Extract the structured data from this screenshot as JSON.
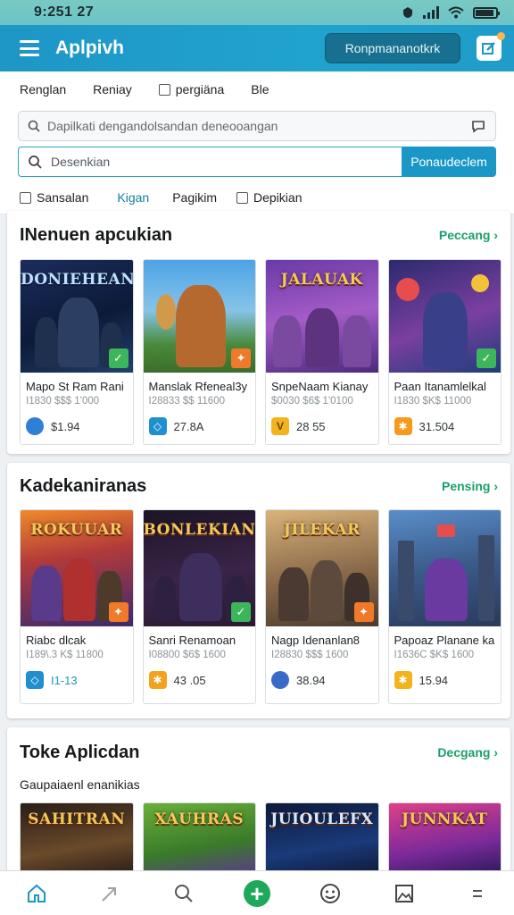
{
  "status_bar": {
    "time": "9:251  27"
  },
  "header": {
    "title": "Aplpivh",
    "action_label": "Ronpmananotkrk",
    "icon": "edit-icon"
  },
  "filters": {
    "item1": "Renglan",
    "item2": "Reniay",
    "item3": "pergiäna",
    "item4": "Ble"
  },
  "search": {
    "top_placeholder": "Dapilkati dengandolsandan  deneooangan",
    "main_placeholder": "Desenkian",
    "button_label": "Ponaudeclem"
  },
  "tabs": {
    "tab1": "Sansalan",
    "tab2": "Kigan",
    "tab3": "Pagikim",
    "tab4": "Depikian"
  },
  "sections": [
    {
      "title": "INenuen apcukian",
      "see_all": "Peccang ›",
      "cards": [
        {
          "art": "DONIEHEAN",
          "name": "Mapo St Ram Rani",
          "sub": "I1830 $$$ 1'000",
          "price": "$1.94"
        },
        {
          "art": "",
          "name": "Manslak Rfeneal3y",
          "sub": "I28833 $$ 11600",
          "price": "27.8A"
        },
        {
          "art": "JALAUAK",
          "name": "SnpeNaam Kianay",
          "sub": "$0030 $6$ 1'0100",
          "price": "28 55"
        },
        {
          "art": "",
          "name": "Paan Itanamlelkal",
          "sub": "I1830 $K$ 11000",
          "price": "31.504"
        }
      ]
    },
    {
      "title": "Kadekaniranas",
      "see_all": "Pensing ›",
      "cards": [
        {
          "art": "ROKUUAR",
          "name": "Riabc dlcak",
          "sub": "I189\\.3 K$ 11800",
          "price": "I1-13"
        },
        {
          "art": "BONLEKIAN",
          "name": "Sanri Renamoan",
          "sub": "I08800 $6$ 1600",
          "price": "43 .05"
        },
        {
          "art": "JILEKAR",
          "name": "Nagp Idenanlan8",
          "sub": "I28830 $$$ 1600",
          "price": "38.94"
        },
        {
          "art": "",
          "name": "Papoaz Planane ka",
          "sub": "I1636C $K$ 1600",
          "price": "15.94"
        }
      ]
    },
    {
      "title": "Toke Aplicdan",
      "see_all": "Decgang ›",
      "subheading": "Gaupaiaenl enanikias",
      "cards": [
        {
          "art": "SAHITRAN",
          "name": "",
          "sub": "",
          "price": ""
        },
        {
          "art": "XAUHRAS",
          "name": "",
          "sub": "",
          "price": ""
        },
        {
          "art": "JUIOULEFX",
          "name": "",
          "sub": "",
          "price": ""
        },
        {
          "art": "JUNNKAT",
          "name": "",
          "sub": "",
          "price": ""
        }
      ]
    }
  ],
  "colors": {
    "accent": "#1a97c6",
    "see_all": "#19a06a",
    "fab": "#1ea95a"
  }
}
